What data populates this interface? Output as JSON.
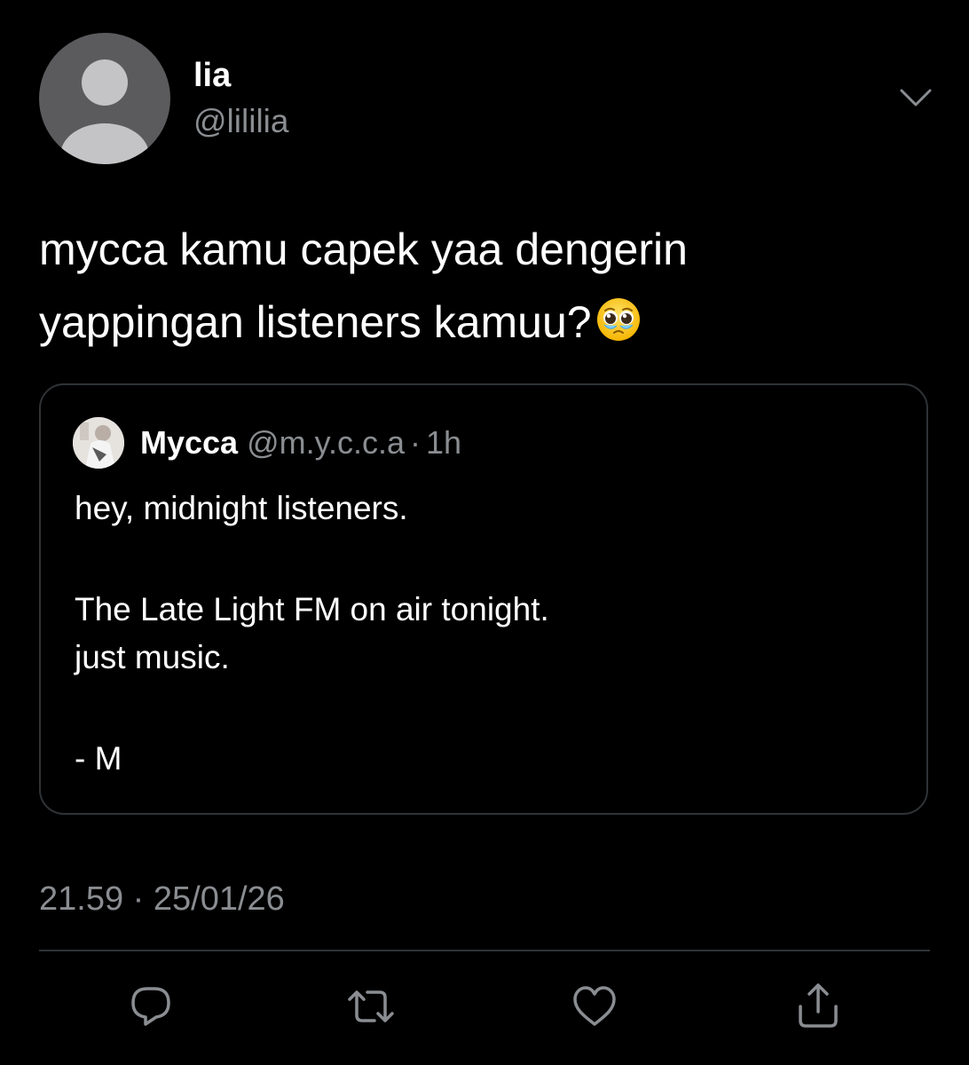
{
  "author": {
    "display_name": "lia",
    "handle": "@lililia",
    "avatar_icon": "default-avatar-icon"
  },
  "tweet": {
    "text_line1": "mycca kamu capek yaa dengerin",
    "text_line2": "yappingan listeners kamuu?",
    "emoji": "pleading-face-with-tears"
  },
  "quoted_tweet": {
    "display_name": "Mycca",
    "handle": "@m.y.c.c.a",
    "separator": "·",
    "time": "1h",
    "lines": [
      "hey, midnight listeners.",
      "",
      "The Late Light FM on air tonight.",
      "just music.",
      "",
      "- M"
    ]
  },
  "timestamp": {
    "time": "21.59",
    "separator": "·",
    "date": "25/01/26"
  },
  "actions": [
    {
      "icon": "reply-icon"
    },
    {
      "icon": "retweet-icon"
    },
    {
      "icon": "like-icon"
    },
    {
      "icon": "share-icon"
    }
  ],
  "colors": {
    "background": "#000000",
    "primary_text": "#ffffff",
    "secondary_text": "#8a8d91",
    "border": "#2f3336",
    "icon": "#8a8d91"
  }
}
